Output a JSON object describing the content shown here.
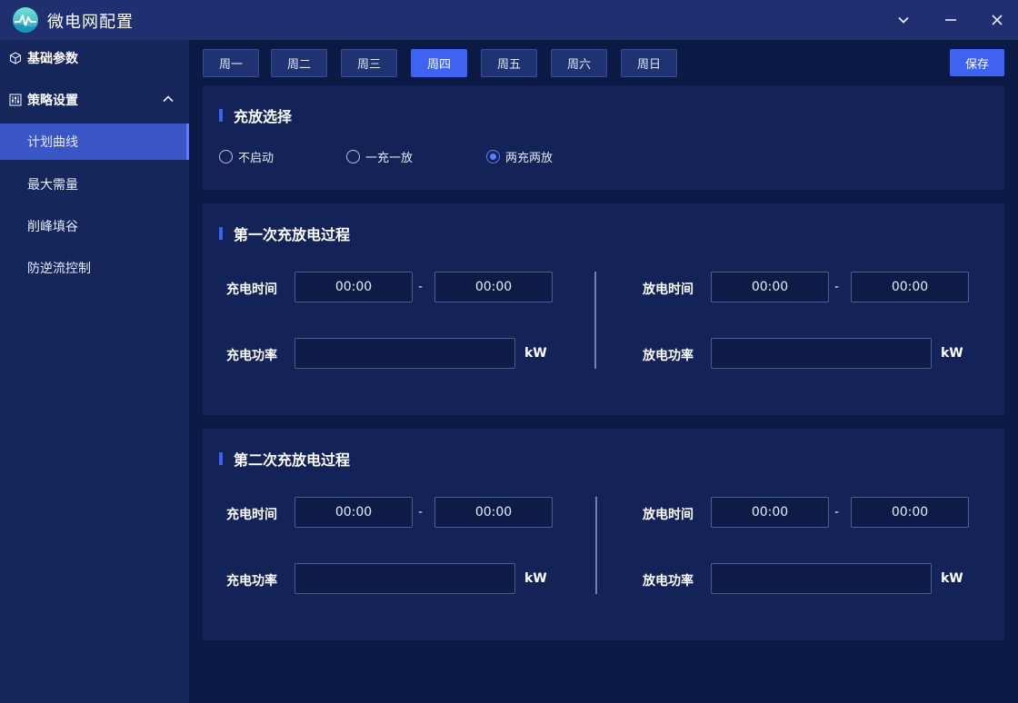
{
  "app": {
    "title": "微电网配置"
  },
  "sidebar": {
    "groups": [
      {
        "label": "基础参数",
        "icon": "cube-icon"
      },
      {
        "label": "策略设置",
        "icon": "sliders-icon"
      }
    ],
    "items": [
      {
        "label": "计划曲线",
        "active": true
      },
      {
        "label": "最大需量",
        "active": false
      },
      {
        "label": "削峰填谷",
        "active": false
      },
      {
        "label": "防逆流控制",
        "active": false
      }
    ]
  },
  "days": [
    "周一",
    "周二",
    "周三",
    "周四",
    "周五",
    "周六",
    "周日"
  ],
  "active_day": "周四",
  "save_label": "保存",
  "mode": {
    "title": "充放选择",
    "options": [
      "不启动",
      "一充一放",
      "两充两放"
    ],
    "selected": "两充两放"
  },
  "processes": [
    {
      "title": "第一次充放电过程",
      "charge_time_label": "充电时间",
      "charge_start": "00:00",
      "charge_end": "00:00",
      "charge_power_label": "充电功率",
      "charge_power": "",
      "discharge_time_label": "放电时间",
      "discharge_start": "00:00",
      "discharge_end": "00:00",
      "discharge_power_label": "放电功率",
      "discharge_power": "",
      "unit": "kW",
      "separator": "-"
    },
    {
      "title": "第二次充放电过程",
      "charge_time_label": "充电时间",
      "charge_start": "00:00",
      "charge_end": "00:00",
      "charge_power_label": "充电功率",
      "charge_power": "",
      "discharge_time_label": "放电时间",
      "discharge_start": "00:00",
      "discharge_end": "00:00",
      "discharge_power_label": "放电功率",
      "discharge_power": "",
      "unit": "kW",
      "separator": "-"
    }
  ],
  "colors": {
    "accent": "#3d63f0",
    "background": "#0b1a45",
    "panel": "#132358",
    "titlebar": "#1f2f70"
  }
}
